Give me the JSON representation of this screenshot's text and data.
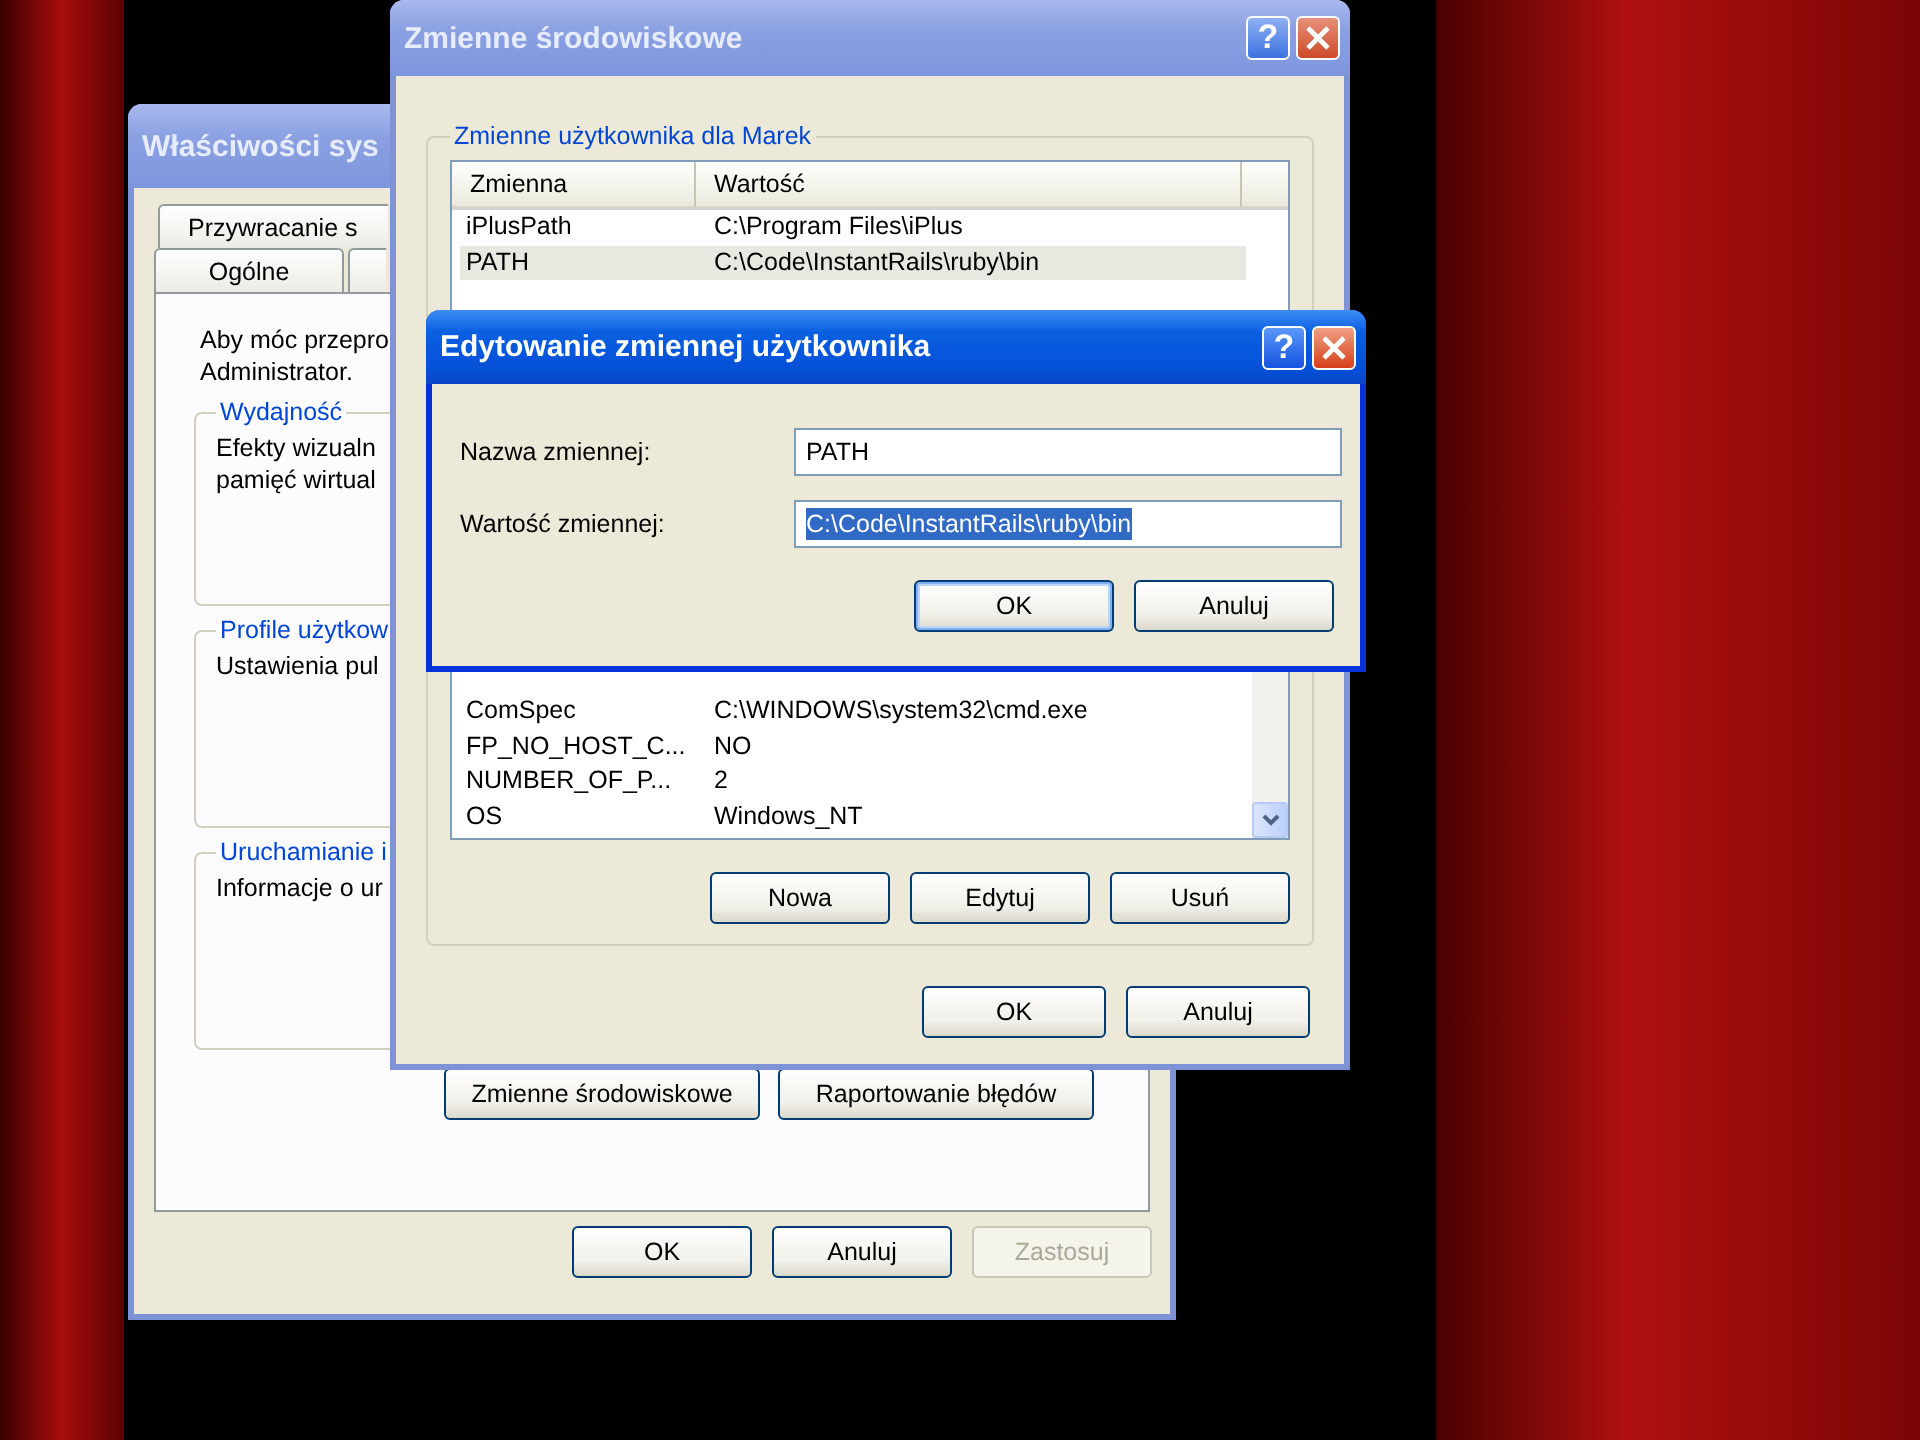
{
  "system_properties": {
    "title": "Właściwości sys",
    "active": false,
    "tab_rows": [
      [
        {
          "label": "Przywracanie s",
          "selected": false
        }
      ],
      [
        {
          "label": "Ogólne",
          "selected": false
        }
      ]
    ],
    "intro_lines": [
      "Aby móc przepro",
      "Administrator."
    ],
    "groups": [
      {
        "title": "Wydajność",
        "lines": [
          "Efekty wizualn",
          "pamięć wirtual"
        ]
      },
      {
        "title": "Profile użytkow",
        "lines": [
          "Ustawienia pul"
        ]
      },
      {
        "title": "Uruchamianie i",
        "lines": [
          "Informacje o ur"
        ]
      }
    ],
    "panel_buttons": [
      "Zmienne środowiskowe",
      "Raportowanie błędów"
    ],
    "buttons": [
      {
        "label": "OK",
        "disabled": false
      },
      {
        "label": "Anuluj",
        "disabled": false
      },
      {
        "label": "Zastosuj",
        "disabled": true
      }
    ]
  },
  "environment": {
    "title": "Zmienne środowiskowe",
    "active": false,
    "help": "?",
    "user_group": "Zmienne użytkownika dla Marek",
    "columns": [
      "Zmienna",
      "Wartość"
    ],
    "user_rows": [
      {
        "name": "iPlusPath",
        "value": "C:\\Program Files\\iPlus",
        "selected": false
      },
      {
        "name": "PATH",
        "value": "C:\\Code\\InstantRails\\ruby\\bin",
        "selected": true
      }
    ],
    "system_rows": [
      {
        "name": "ComSpec",
        "value": "C:\\WINDOWS\\system32\\cmd.exe",
        "selected": false
      },
      {
        "name": "FP_NO_HOST_C...",
        "value": "NO",
        "selected": false
      },
      {
        "name": "NUMBER_OF_P...",
        "value": "2",
        "selected": false
      },
      {
        "name": "OS",
        "value": "Windows_NT",
        "selected": false
      }
    ],
    "list_buttons": [
      "Nowa",
      "Edytuj",
      "Usuń"
    ],
    "buttons": [
      "OK",
      "Anuluj"
    ]
  },
  "edit_dialog": {
    "title": "Edytowanie zmiennej użytkownika",
    "active": true,
    "help": "?",
    "fields": [
      {
        "label": "Nazwa zmiennej:",
        "value": "PATH",
        "selected": false
      },
      {
        "label": "Wartość zmiennej:",
        "value": "C:\\Code\\InstantRails\\ruby\\bin",
        "selected": true
      }
    ],
    "buttons": [
      {
        "label": "OK",
        "default": true
      },
      {
        "label": "Anuluj",
        "default": false
      }
    ]
  }
}
